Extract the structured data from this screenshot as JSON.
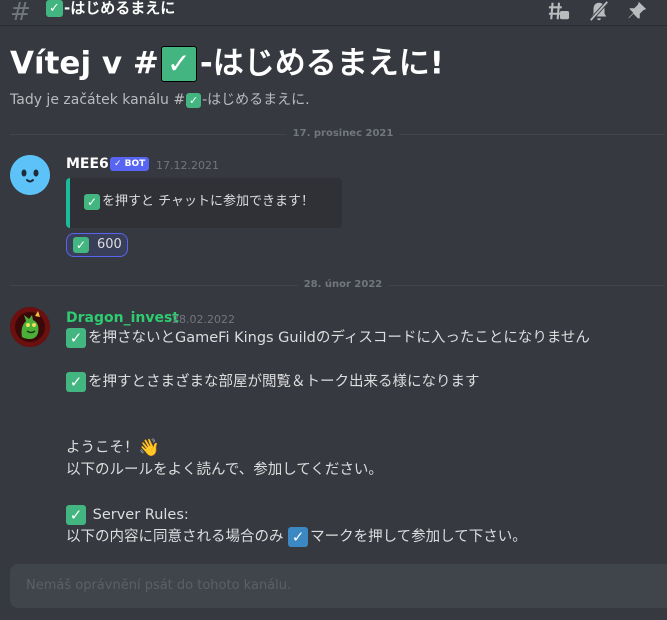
{
  "header": {
    "channel_emoji": "✓",
    "channel_name": "-はじめるまえに",
    "icons": [
      "threads-icon",
      "notification-muted-icon",
      "pin-icon"
    ]
  },
  "intro": {
    "title_prefix": "Vítej v #",
    "title_emoji": "✓",
    "title_suffix": "-はじめるまえに!",
    "subtitle_prefix": "Tady je začátek kanálu #",
    "subtitle_emoji": "✓",
    "subtitle_suffix": "-はじめるまえに."
  },
  "dividers": [
    "17. prosinec 2021",
    "28. únor 2022"
  ],
  "messages": [
    {
      "author": "MEE6",
      "author_color": "#ffffff",
      "bot_tag": "✓ BOT",
      "timestamp": "17.12.2021",
      "embed_emoji": "✓",
      "embed_text": "を押すと チャットに参加できます！",
      "reaction_emoji": "✓",
      "reaction_count": "600"
    },
    {
      "author": "Dragon_invest",
      "author_color": "#2ecc71",
      "timestamp": "28.02.2022",
      "lines": [
        {
          "emoji": "✓",
          "text": "を押さないとGameFi Kings Guildのディスコードに入ったことになりません"
        },
        {
          "emoji": "✓",
          "text": "を押すとさまざまな部屋が閲覧＆トーク出来る様になります"
        },
        {
          "text": "ようこそ！",
          "emoji_after": "👋"
        },
        {
          "text": "以下のルールをよく読んで、参加してください。"
        },
        {
          "emoji": "✓",
          "text": " Server Rules:"
        },
        {
          "text_before": "以下の内容に同意される場合のみ ",
          "emoji_blue": "✓",
          "text": "マークを押して参加して下さい。"
        }
      ]
    }
  ],
  "input": {
    "placeholder": "Nemáš oprávnění psát do tohoto kanálu."
  },
  "colors": {
    "background": "#36393f",
    "accent": "#5865f2",
    "embed_border": "#1abc9c",
    "check_green": "#43b581",
    "check_blue": "#3b88c3"
  }
}
